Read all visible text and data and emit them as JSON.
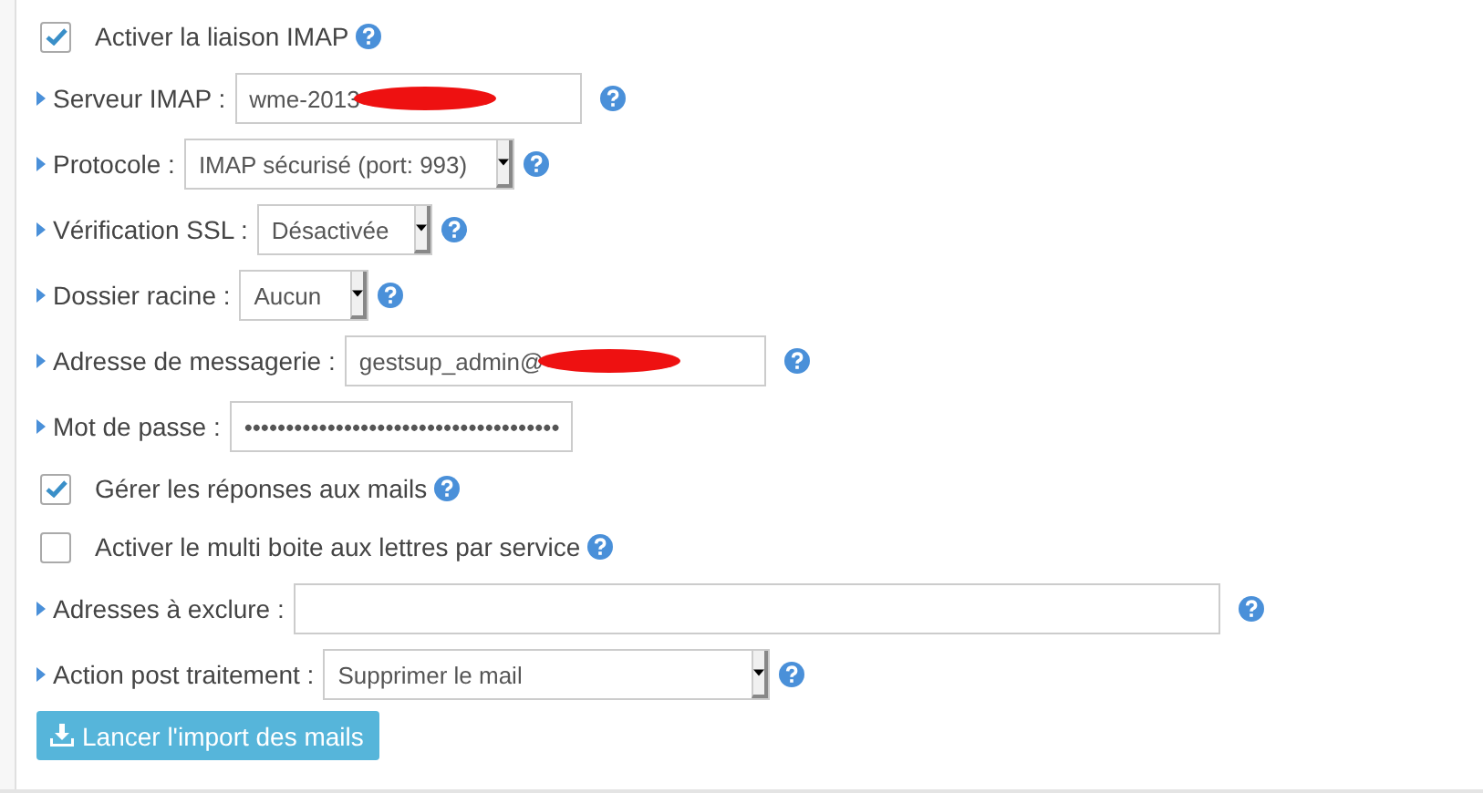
{
  "rows": [
    {
      "kind": "checkbox",
      "label": "Activer la liaison IMAP",
      "checked": true,
      "help": true
    },
    {
      "kind": "text",
      "label": "Serveur IMAP :",
      "value": "wme-2013",
      "redacted": true,
      "help": true
    },
    {
      "kind": "select",
      "label": "Protocole :",
      "value": "IMAP sécurisé (port: 993)",
      "help": true
    },
    {
      "kind": "select",
      "label": "Vérification SSL :",
      "value": "Désactivée",
      "help": true
    },
    {
      "kind": "select",
      "label": "Dossier racine :",
      "value": "Aucun",
      "help": true
    },
    {
      "kind": "text",
      "label": "Adresse de messagerie :",
      "value": "gestsup_admin@",
      "redacted": true,
      "help": true
    },
    {
      "kind": "text",
      "label": "Mot de passe :",
      "value": "••••••••••••••••••••••••••••••••••••••",
      "redacted": false,
      "help": false
    },
    {
      "kind": "checkbox",
      "label": "Gérer les réponses aux mails",
      "checked": true,
      "help": true
    },
    {
      "kind": "checkbox",
      "label": "Activer le multi boite aux lettres par service",
      "checked": false,
      "help": true
    },
    {
      "kind": "text",
      "label": "Adresses à exclure :",
      "value": "",
      "redacted": false,
      "help": true
    },
    {
      "kind": "select",
      "label": "Action post traitement :",
      "value": "Supprimer le mail",
      "help": true
    },
    {
      "kind": "button",
      "label": "Lancer l'import des mails"
    }
  ]
}
